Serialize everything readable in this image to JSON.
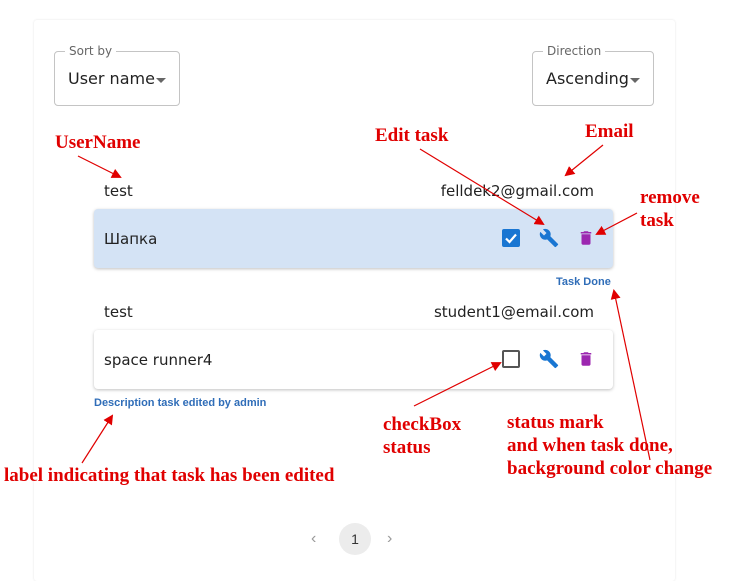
{
  "sort": {
    "legend": "Sort by",
    "value": "User name"
  },
  "direction": {
    "legend": "Direction",
    "value": "Ascending"
  },
  "tasks": [
    {
      "user": "test",
      "email": "felldek2@gmail.com",
      "title": "Шапка",
      "done": true,
      "status_label": "Task Done",
      "background": "#d4e3f5"
    },
    {
      "user": "test",
      "email": "student1@email.com",
      "title": "space runner4",
      "done": false,
      "edited_label": "Description task edited by admin",
      "background": "#ffffff"
    }
  ],
  "pagination": {
    "page": "1"
  },
  "annotations": {
    "username": "UserName",
    "edit_task": "Edit task",
    "email": "Email",
    "remove_task_1": "remove",
    "remove_task_2": "task",
    "checkbox_1": "checkBox",
    "checkbox_2": "status",
    "status_1": "status mark",
    "status_2": "and when task done,",
    "status_3": "background color change",
    "edited_label": "label indicating that task has been edited"
  },
  "colors": {
    "accent": "#1976d2",
    "delete": "#9c27b0",
    "annotation": "#e00000",
    "link": "#2f6db8"
  },
  "icons": {
    "edit": "wrench-icon",
    "remove": "trash-icon",
    "prev": "chevron-left-icon",
    "next": "chevron-right-icon"
  }
}
